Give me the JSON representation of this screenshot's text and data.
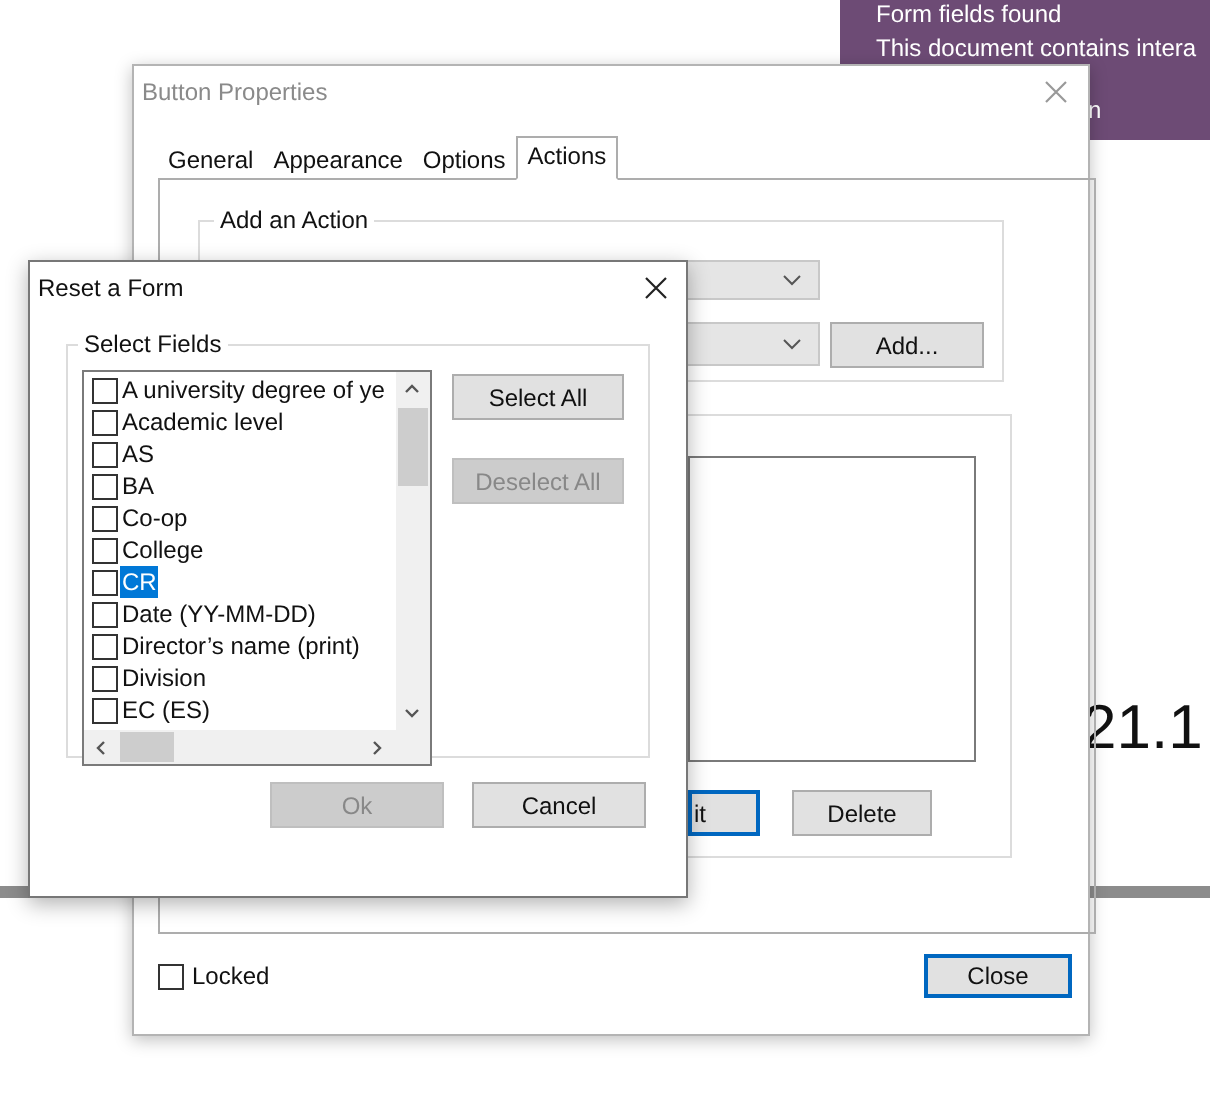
{
  "background": {
    "notification": {
      "heading": "Form fields found",
      "message": "This document contains intera",
      "fragment": "n"
    },
    "page_text": "21.1"
  },
  "properties_window": {
    "title": "Button Properties",
    "tabs": [
      {
        "label": "General",
        "selected": false
      },
      {
        "label": "Appearance",
        "selected": false
      },
      {
        "label": "Options",
        "selected": false
      },
      {
        "label": "Actions",
        "selected": true
      }
    ],
    "action_group": {
      "title": "Add an Action",
      "add_button": "Add..."
    },
    "edit_button": "it",
    "delete_button": "Delete",
    "locked": {
      "label": "Locked",
      "checked": false
    },
    "close_button": "Close"
  },
  "reset_dialog": {
    "title": "Reset a Form",
    "group_title": "Select Fields",
    "fields": [
      {
        "label": "A university degree of ye",
        "checked": false,
        "selected": false
      },
      {
        "label": "Academic level",
        "checked": false,
        "selected": false
      },
      {
        "label": "AS",
        "checked": false,
        "selected": false
      },
      {
        "label": "BA",
        "checked": false,
        "selected": false
      },
      {
        "label": "Co-op",
        "checked": false,
        "selected": false
      },
      {
        "label": "College",
        "checked": false,
        "selected": false
      },
      {
        "label": "CR",
        "checked": false,
        "selected": true
      },
      {
        "label": "Date (YY-MM-DD)",
        "checked": false,
        "selected": false
      },
      {
        "label": "Director’s name (print)",
        "checked": false,
        "selected": false
      },
      {
        "label": "Division",
        "checked": false,
        "selected": false
      },
      {
        "label": "EC (ES)",
        "checked": false,
        "selected": false
      }
    ],
    "select_all": {
      "label": "Select All",
      "disabled": false
    },
    "deselect_all": {
      "label": "Deselect All",
      "disabled": true
    },
    "ok": {
      "label": "Ok",
      "disabled": true
    },
    "cancel": {
      "label": "Cancel",
      "disabled": false
    }
  }
}
